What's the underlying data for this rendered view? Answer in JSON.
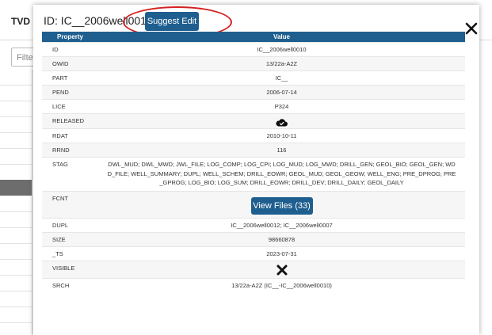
{
  "background": {
    "column_title": "TVD (m",
    "filter_placeholder": "Filter..."
  },
  "modal": {
    "title": "ID: IC__2006well0010",
    "suggest_label": "Suggest Edit",
    "close_icon": "close-icon",
    "headers": {
      "property": "Property",
      "value": "Value"
    },
    "rows": [
      {
        "key": "ID",
        "value": "IC__2006well0010"
      },
      {
        "key": "OWID",
        "value": "13/22a-A2Z"
      },
      {
        "key": "PART",
        "value": "IC__"
      },
      {
        "key": "PEND",
        "value": "2006-07-14"
      },
      {
        "key": "LICE",
        "value": "P324"
      },
      {
        "key": "RELEASED",
        "value": "",
        "icon": "cloud-check-icon"
      },
      {
        "key": "RDAT",
        "value": "2010-10-11"
      },
      {
        "key": "RRND",
        "value": "116"
      },
      {
        "key": "STAG",
        "value": "DWL_MUD; DWL_MWD; JWL_FILE; LOG_COMP; LOG_CPI; LOG_MUD; LOG_MWD; DRILL_GEN; GEOL_BIO; GEOL_GEN; WD D_FILE; WELL_SUMMARY; DUPL; WELL_SCHEM; DRILL_EOWR; GEOL_MUD; GEOL_GEOW; WELL_ENG; PRE_DPROG; PRE _GPROG; LOG_BIO; LOG_SUM; DRILL_EOWR; DRILL_DEV; DRILL_DAILY; GEOL_DAILY"
      },
      {
        "key": "FCNT",
        "value": "",
        "button": "View Files (33)"
      },
      {
        "key": "DUPL",
        "value": "IC__2006well0012; IC__2006well0007"
      },
      {
        "key": "SIZE",
        "value": "98660878"
      },
      {
        "key": "_TS",
        "value": "2023-07-31"
      },
      {
        "key": "VISIBLE",
        "value": "",
        "icon": "cross-icon"
      },
      {
        "key": "SRCH",
        "value": "13/22a-A2Z (IC__-IC__2006well0010)"
      }
    ]
  },
  "colors": {
    "accent": "#1f5f8f",
    "annotation": "#d42020",
    "selected_row": "#6d6d6d"
  }
}
